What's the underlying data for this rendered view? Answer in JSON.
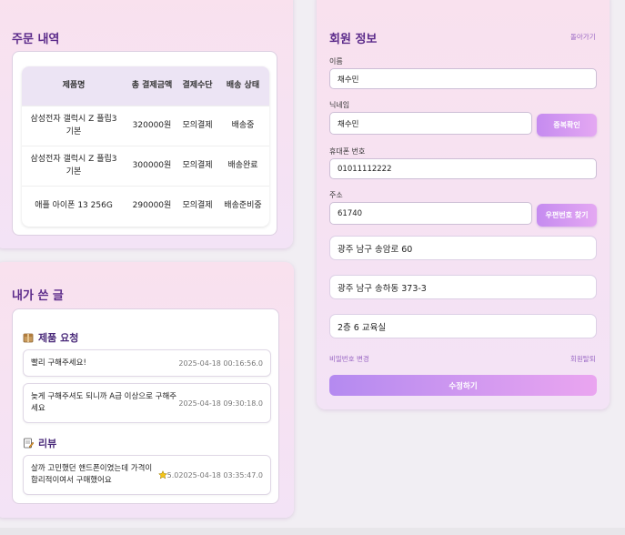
{
  "orders": {
    "title": "주문 내역",
    "columns": [
      "제품명",
      "총 결제금액",
      "결제수단",
      "배송 상태"
    ],
    "rows": [
      {
        "product": "삼성전자 갤럭시 Z 플립3 기본",
        "amount": "320000원",
        "method": "모의결제",
        "status": "배송중"
      },
      {
        "product": "삼성전자 갤럭시 Z 플립3 기본",
        "amount": "300000원",
        "method": "모의결제",
        "status": "배송완료"
      },
      {
        "product": "애플 아이폰 13 256G",
        "amount": "290000원",
        "method": "모의결제",
        "status": "배송준비중"
      }
    ]
  },
  "posts": {
    "title": "내가 쓴 글",
    "requests": {
      "heading": "제품 요청",
      "items": [
        {
          "text": "빨리 구해주세요!",
          "date": "2025-04-18 00:16:56.0"
        },
        {
          "text": "늦게 구해주셔도 되니까 A급 이상으로 구해주세요",
          "date": "2025-04-18 09:30:18.0"
        }
      ]
    },
    "reviews": {
      "heading": "리뷰",
      "items": [
        {
          "text": "살까 고민했던 핸드폰이였는데 가격이 합리적이여서 구매했어요",
          "rating": "5.0",
          "date": "2025-04-18 03:35:47.0"
        }
      ]
    }
  },
  "member": {
    "title": "회원 정보",
    "back_link": "돌아가기",
    "name_label": "이름",
    "name_value": "채수민",
    "nickname_label": "닉네임",
    "nickname_value": "채수민",
    "dup_check_button": "중복확인",
    "phone_label": "휴대폰 번호",
    "phone_value": "01011112222",
    "address_label": "주소",
    "postcode_value": "61740",
    "postcode_button": "우편번호 찾기",
    "address1_value": "광주 남구 송암로 60",
    "address2_value": "광주 남구 송하동 373-3",
    "address3_value": "2층 6 교육실",
    "change_password_link": "비밀번호 변경",
    "withdraw_link": "회원탈퇴",
    "submit_button": "수정하기"
  },
  "colors": {
    "accent": "#5b2a8a",
    "button_gradient_start": "#c58bf0",
    "button_gradient_end": "#e4a8f2",
    "star": "#f5c518"
  },
  "icons": {
    "request_section": "box-icon",
    "review_section": "memo-icon",
    "rating": "star-icon"
  }
}
